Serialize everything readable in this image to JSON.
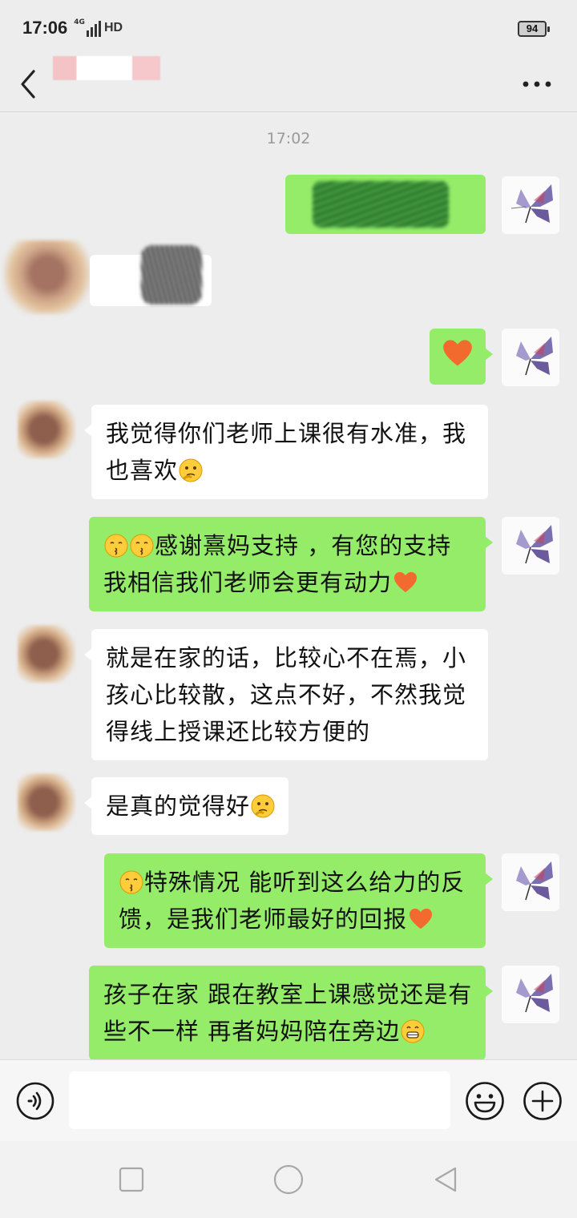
{
  "status": {
    "time": "17:06",
    "network": "4G",
    "hd": "HD",
    "battery": "94"
  },
  "header": {
    "title": ""
  },
  "messages": {
    "time_label": "17:02",
    "m4": {
      "text": "我觉得你们老师上课很有水准，我也喜欢",
      "emoji": "thinking-face"
    },
    "m5": {
      "text": "感谢熹妈支持 ，有您的支持我相信我们老师会更有动力",
      "emoji_before": [
        "kissing-face",
        "kissing-face"
      ],
      "emoji_after": "orange-heart"
    },
    "m6": {
      "text": "就是在家的话，比较心不在焉，小孩心比较散，这点不好，不然我觉得线上授课还比较方便的"
    },
    "m7": {
      "text": "是真的觉得好",
      "emoji": "thinking-face"
    },
    "m8": {
      "text": "特殊情况  能听到这么给力的反馈，是我们老师最好的回报",
      "emoji_before": "kissing-face",
      "emoji_after": "orange-heart"
    },
    "m9": {
      "text": "孩子在家 跟在教室上课感觉还是有些不一样  再者妈妈陪在旁边",
      "emoji": "grinning-face"
    }
  },
  "input": {
    "placeholder": ""
  },
  "colors": {
    "my_bubble": "#95ec69",
    "other_bubble": "#ffffff",
    "background": "#ededed",
    "heart": "#f26a2e"
  }
}
